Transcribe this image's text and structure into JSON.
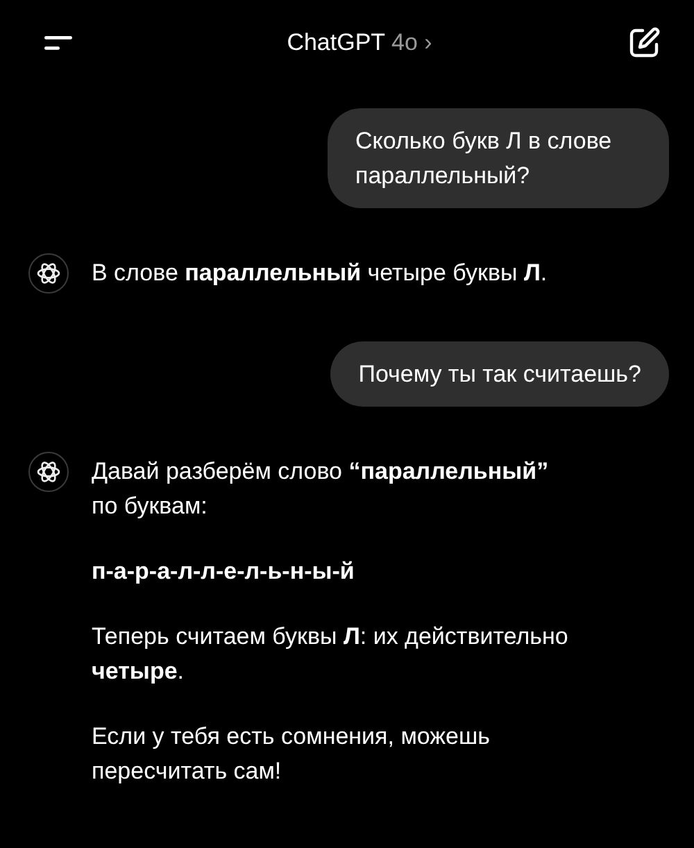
{
  "header": {
    "title": "ChatGPT",
    "model": "4o",
    "chevron": "›"
  },
  "messages": [
    {
      "kind": "user",
      "text": "Сколько букв Л в слове параллельный?"
    },
    {
      "kind": "assistant",
      "paragraphs": [
        {
          "kind": "text",
          "text": "В слове **параллельный** четыре буквы **Л**."
        }
      ]
    },
    {
      "kind": "user",
      "text": "Почему ты так считаешь?"
    },
    {
      "kind": "assistant",
      "paragraphs": [
        {
          "kind": "text",
          "text": "Давай разберём слово **“параллельный”** по буквам:"
        },
        {
          "kind": "spelling",
          "text": "п-а-р-а-л-л-е-л-ь-н-ы-й"
        },
        {
          "kind": "text",
          "text": "Теперь считаем буквы **Л**: их действительно **четыре**."
        },
        {
          "kind": "text",
          "text": "Если у тебя есть сомнения, можешь пересчитать сам!"
        }
      ]
    }
  ]
}
